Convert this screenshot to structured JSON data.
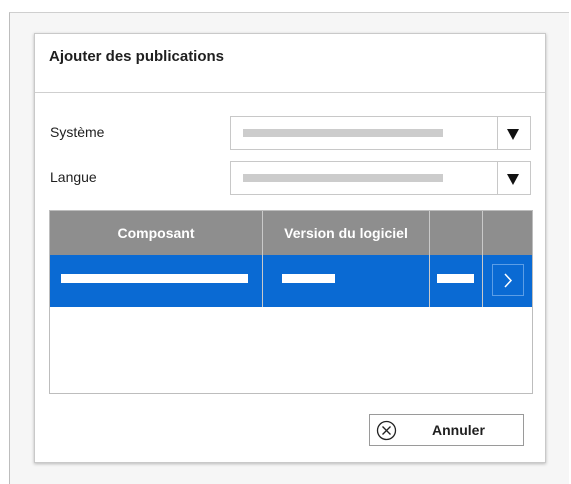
{
  "dialog": {
    "title": "Ajouter des publications"
  },
  "fields": {
    "system_label": "Système",
    "language_label": "Langue"
  },
  "table": {
    "columns": [
      "Composant",
      "Version du logiciel",
      ""
    ],
    "selected_row_color": "#0a6ad3",
    "header_color": "#8e8e8e"
  },
  "actions": {
    "cancel_label": "Annuler"
  },
  "icons": {
    "dropdown_arrow": "triangle-down-icon",
    "row_arrow": "chevron-right-icon",
    "cancel": "circle-x-icon"
  }
}
